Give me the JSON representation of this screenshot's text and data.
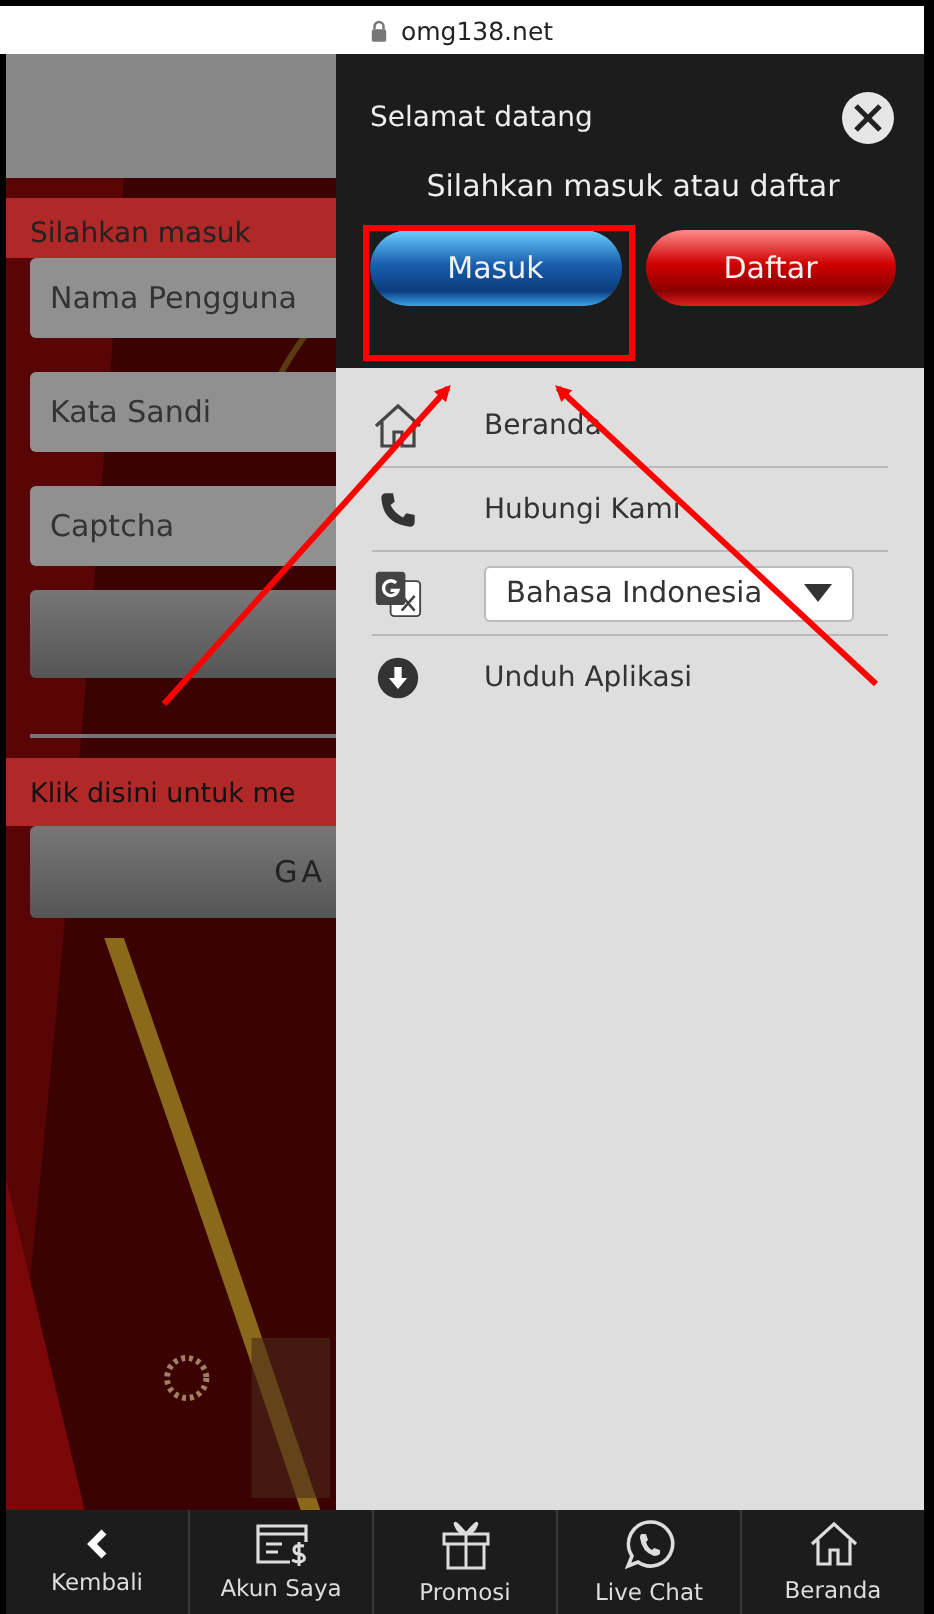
{
  "address_bar": {
    "url": "omg138.net"
  },
  "background_page": {
    "heading": "Silahkan masuk",
    "fields": [
      {
        "placeholder": "Nama Pengguna"
      },
      {
        "placeholder": "Kata Sandi"
      },
      {
        "placeholder": "Captcha"
      }
    ],
    "note": "Klik disini untuk me",
    "button": "GA"
  },
  "drawer": {
    "title": "Selamat datang",
    "prompt": "Silahkan masuk atau daftar",
    "buttons": [
      {
        "label": "Masuk",
        "kind": "login"
      },
      {
        "label": "Daftar",
        "kind": "register"
      }
    ],
    "items": [
      {
        "kind": "home",
        "label": "Beranda"
      },
      {
        "kind": "phone",
        "label": "Hubungi Kami"
      },
      {
        "kind": "language",
        "value": "Bahasa Indonesia"
      },
      {
        "kind": "download",
        "label": "Unduh Aplikasi"
      }
    ]
  },
  "bottom_nav": [
    {
      "kind": "back",
      "label": "Kembali"
    },
    {
      "kind": "account",
      "label": "Akun Saya"
    },
    {
      "kind": "promo",
      "label": "Promosi"
    },
    {
      "kind": "chat",
      "label": "Live Chat"
    },
    {
      "kind": "home",
      "label": "Beranda"
    }
  ]
}
